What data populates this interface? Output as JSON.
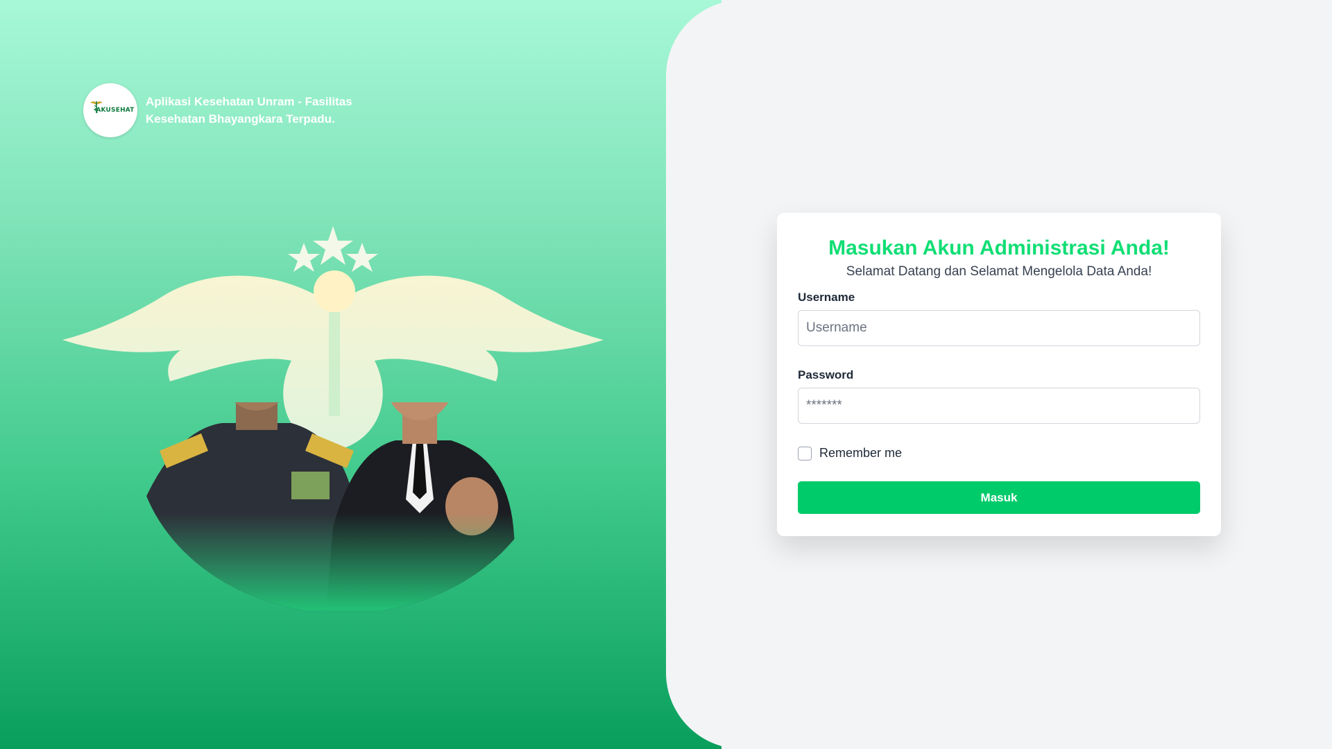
{
  "brand": {
    "logo_text": "AKUSEHAT",
    "tagline": "Aplikasi Kesehatan Unram - Fasilitas Kesehatan Bhayangkara Terpadu."
  },
  "hero": {
    "description": "illustration-caduceus-emblem-with-portraits"
  },
  "login": {
    "title": "Masukan Akun Administrasi Anda!",
    "subtitle": "Selamat Datang dan Selamat Mengelola Data Anda!",
    "username_label": "Username",
    "username_placeholder": "Username",
    "password_label": "Password",
    "password_placeholder": "*******",
    "remember_label": "Remember me",
    "submit_label": "Masuk"
  },
  "colors": {
    "accent": "#10de74",
    "button": "#00cb6a",
    "gradient_top": "#a7f8d7",
    "gradient_bottom": "#099e5c",
    "panel_bg": "#f3f4f6"
  }
}
